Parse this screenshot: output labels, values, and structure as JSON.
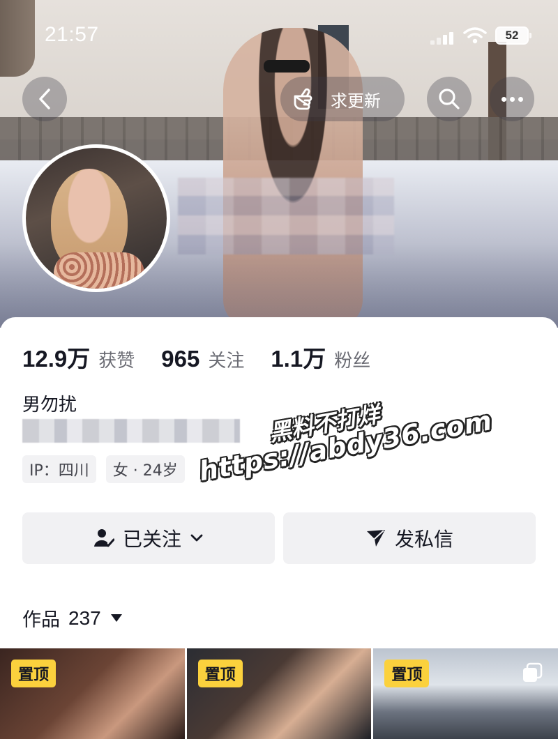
{
  "status_bar": {
    "time": "21:57",
    "battery": "52"
  },
  "header": {
    "update_request_label": "求更新"
  },
  "stats": [
    {
      "value": "12.9万",
      "label": "获赞"
    },
    {
      "value": "965",
      "label": "关注"
    },
    {
      "value": "1.1万",
      "label": "粉丝"
    }
  ],
  "profile": {
    "nickname": "男勿扰",
    "tags": [
      "IP：四川",
      "女 · 24岁"
    ]
  },
  "actions": {
    "follow_label": "已关注",
    "message_label": "发私信"
  },
  "works": {
    "label": "作品",
    "count": "237"
  },
  "videos": [
    {
      "badge": "置顶"
    },
    {
      "badge": "置顶"
    },
    {
      "badge": "置顶"
    }
  ],
  "watermark": {
    "line1": "黑料不打烊",
    "line2": "https://abdy36.com"
  },
  "colors": {
    "accent_badge": "#fbd13d",
    "text_primary": "#161823",
    "text_secondary": "#6a6b73",
    "button_bg": "#f1f1f3"
  }
}
